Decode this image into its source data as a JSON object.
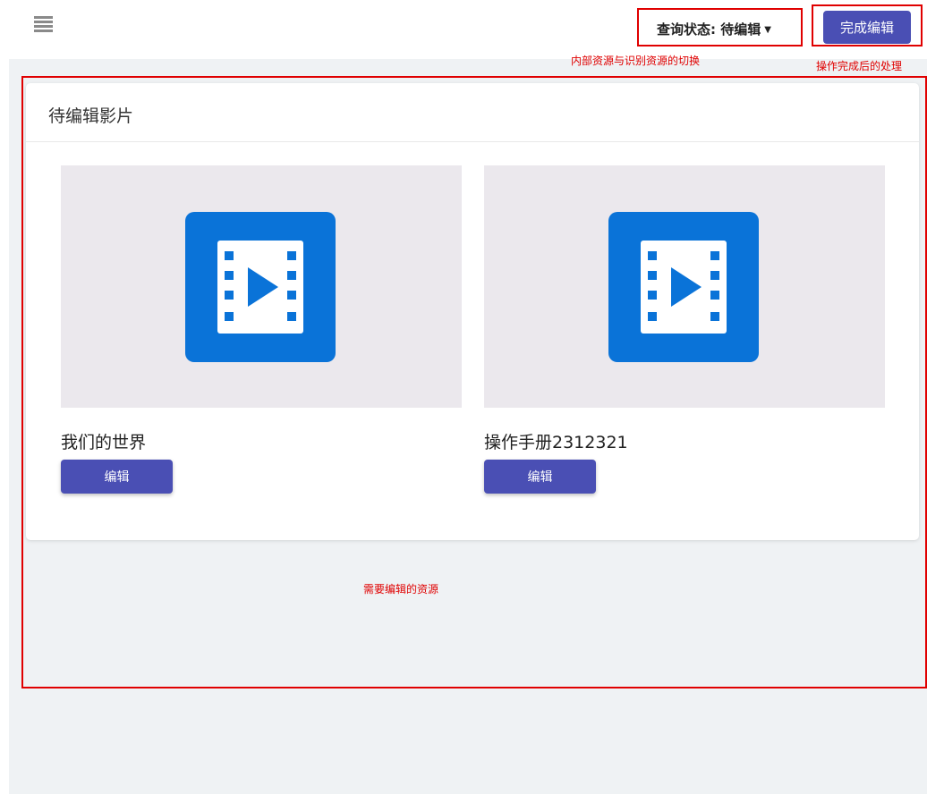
{
  "header": {
    "menu_icon": "menu-icon",
    "status_label": "查询状态:",
    "status_value": "待编辑",
    "done_label": "完成编辑"
  },
  "annotations": {
    "status_note": "内部资源与识别资源的切换",
    "done_note": "操作完成后的处理",
    "content_note": "需要编辑的资源"
  },
  "card": {
    "title": "待编辑影片",
    "items": [
      {
        "title": "我们的世界",
        "edit_label": "编辑",
        "icon": "video-icon"
      },
      {
        "title": "操作手册2312321",
        "edit_label": "编辑",
        "icon": "video-icon"
      }
    ]
  },
  "colors": {
    "accent": "#4a4fb4",
    "video_icon": "#0a73d8",
    "thumb_bg": "#ebe8ed",
    "annotation": "#e00000",
    "workspace_bg": "#eff2f4"
  }
}
